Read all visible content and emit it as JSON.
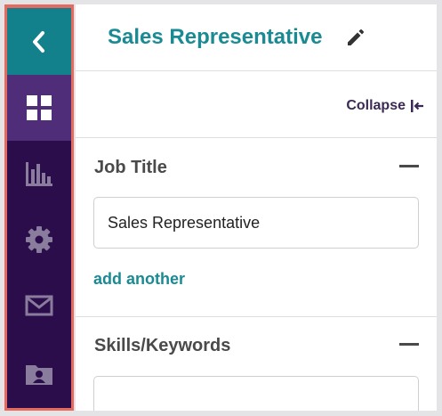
{
  "sidebar": {
    "items": [
      {
        "icon": "chevron-left-icon"
      },
      {
        "icon": "dashboard-grid-icon"
      },
      {
        "icon": "bar-chart-icon"
      },
      {
        "icon": "gear-icon"
      },
      {
        "icon": "mail-icon"
      },
      {
        "icon": "contact-card-icon"
      }
    ],
    "colors": {
      "bg": "#2a0d4a",
      "active": "#4f2d79",
      "back": "#13818c",
      "highlight_border": "#e86a5e"
    }
  },
  "header": {
    "title": "Sales Representative",
    "edit_icon": "pencil-icon"
  },
  "toolbar": {
    "collapse_label": "Collapse",
    "collapse_icon": "collapse-left-icon"
  },
  "job_title_section": {
    "title": "Job Title",
    "value": "Sales Representative",
    "add_label": "add another"
  },
  "skills_section": {
    "title": "Skills/Keywords",
    "value": ""
  },
  "colors": {
    "accent": "#1a8a93",
    "text": "#4a4a4a"
  }
}
